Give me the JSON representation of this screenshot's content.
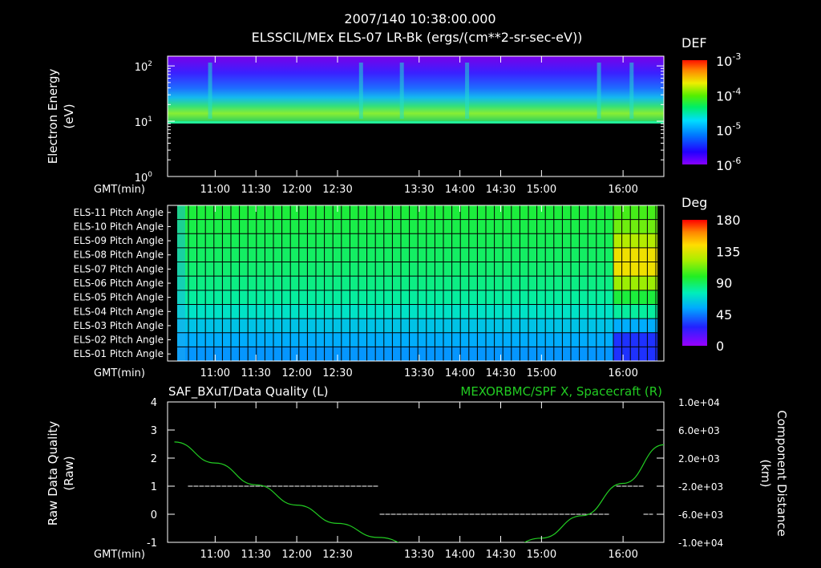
{
  "header": {
    "timestamp": "2007/140 10:38:00.000",
    "title": "ELSSCIL/MEx ELS-07 LR-Bk  (ergs/(cm**2-sr-sec-eV))"
  },
  "time_axis_label": "GMT(min)",
  "time_ticks": [
    "11:00",
    "11:30",
    "12:00",
    "12:30",
    "13:30",
    "14:00",
    "14:30",
    "15:00",
    "16:00"
  ],
  "colors": {
    "background": "#000000",
    "foreground": "#ffffff",
    "right_axis_series": "#22cc22"
  },
  "chart_data": [
    {
      "type": "heatmap",
      "title": "ELSSCIL/MEx ELS-07 LR-Bk  (ergs/(cm**2-sr-sec-eV))",
      "ylabel_line1": "Electron Energy",
      "ylabel_line2": "(eV)",
      "yscale": "log",
      "ylim": [
        1,
        150
      ],
      "ytick_bases": [
        "10",
        "10",
        "10"
      ],
      "ytick_exps": [
        "0",
        "1",
        "2"
      ],
      "colorbar_label": "DEF",
      "colorbar_ticks_bases": [
        "10",
        "10",
        "10",
        "10"
      ],
      "colorbar_ticks_exps": [
        "-6",
        "-5",
        "-4",
        "-3"
      ],
      "colorbar_colors": [
        "#8800ff",
        "#0000ff",
        "#00aaff",
        "#00ffcc",
        "#22dd22",
        "#ccee00",
        "#ffcc00",
        "#ff6600",
        "#ff0000"
      ],
      "data_floor_eV": 10,
      "spike_times": [
        "10:56",
        "12:47",
        "13:17",
        "14:05",
        "15:42",
        "16:06"
      ]
    },
    {
      "type": "heatmap",
      "colorbar_label": "Deg",
      "colorbar_ticks": [
        "0",
        "45",
        "90",
        "135",
        "180"
      ],
      "rows": [
        "ELS-11 Pitch Angle",
        "ELS-10 Pitch Angle",
        "ELS-09 Pitch Angle",
        "ELS-08 Pitch Angle",
        "ELS-07 Pitch Angle",
        "ELS-06 Pitch Angle",
        "ELS-05 Pitch Angle",
        "ELS-04 Pitch Angle",
        "ELS-03 Pitch Angle",
        "ELS-02 Pitch Angle",
        "ELS-01 Pitch Angle"
      ],
      "pitch_angle_deg_main": [
        95,
        93,
        91,
        89,
        87,
        84,
        80,
        72,
        62,
        55,
        50
      ],
      "pitch_angle_deg_late": [
        105,
        112,
        125,
        140,
        140,
        120,
        95,
        80,
        55,
        30,
        30
      ]
    },
    {
      "type": "line",
      "title_left": "SAF_BXuT/Data Quality (L)",
      "title_right": "MEXORBMC/SPF X, Spacecraft (R)",
      "ylabel_left_line1": "Raw Data Quality",
      "ylabel_left_line2": "(Raw)",
      "ylabel_right_line1": "Component Distance",
      "ylabel_right_line2": "(km)",
      "ylim_left": [
        -1,
        4
      ],
      "yticks_left": [
        "-1",
        "0",
        "1",
        "2",
        "3",
        "4"
      ],
      "ylim_right": [
        -10000,
        10000
      ],
      "yticks_right": [
        "-1.0e+04",
        "-6.0e+03",
        "-2.0e+03",
        "2.0e+03",
        "6.0e+03",
        "1.0e+04"
      ],
      "series": [
        {
          "axis": "left",
          "segments": [
            {
              "from": "10:40",
              "to": "13:00",
              "value": 1
            },
            {
              "from": "13:01",
              "to": "15:50",
              "value": 0
            },
            {
              "from": "15:55",
              "to": "16:15",
              "value": 1
            },
            {
              "from": "16:15",
              "to": "16:22",
              "value": 0
            }
          ]
        },
        {
          "axis": "right",
          "x": [
            "10:30",
            "11:00",
            "11:30",
            "12:00",
            "12:30",
            "13:00",
            "13:30",
            "14:00",
            "14:30",
            "15:00",
            "15:30",
            "16:00",
            "16:30"
          ],
          "values": [
            4300,
            1300,
            -1800,
            -4700,
            -7300,
            -9300,
            -10800,
            -11800,
            -11200,
            -9400,
            -6200,
            -1600,
            3900
          ]
        }
      ]
    }
  ]
}
